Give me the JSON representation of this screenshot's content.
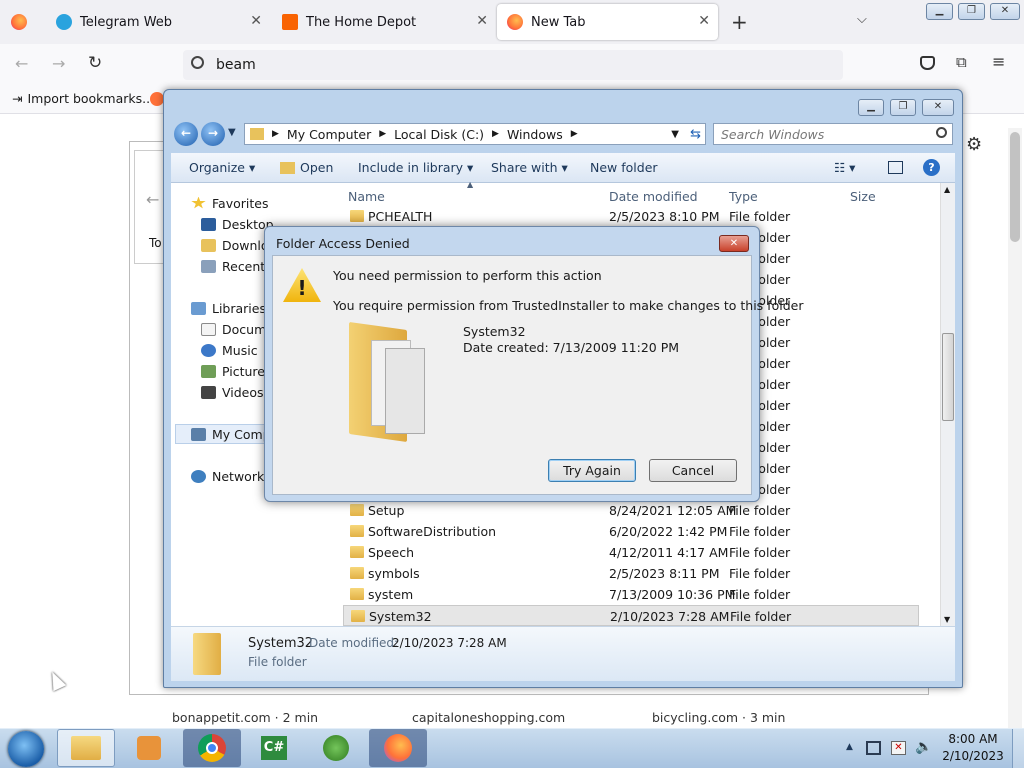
{
  "browser": {
    "tabs": [
      {
        "title": "Telegram Web",
        "icon": "telegram-icon",
        "color": "#2aa3de"
      },
      {
        "title": "The Home Depot",
        "icon": "home-depot-icon",
        "color": "#f96302"
      },
      {
        "title": "New Tab",
        "icon": "firefox-icon",
        "color": "#ff7139"
      }
    ],
    "url": "beam",
    "bookmarks": {
      "import_label": "Import bookmarks..."
    },
    "newtab": {
      "partial_text": "To",
      "story_labels": [
        "bonappetit.com · 2 min",
        "capitaloneshopping.com",
        "bicycling.com · 3 min"
      ]
    }
  },
  "explorer": {
    "breadcrumb": [
      "My Computer",
      "Local Disk (C:)",
      "Windows"
    ],
    "search_placeholder": "Search Windows",
    "commands": [
      "Organize",
      "Open",
      "Include in library",
      "Share with",
      "New folder"
    ],
    "nav": {
      "favorites_header": "Favorites",
      "favorites": [
        "Desktop",
        "Downloads",
        "Recent Places"
      ],
      "libraries_header": "Libraries",
      "libraries": [
        "Documents",
        "Music",
        "Pictures",
        "Videos"
      ],
      "computer": "My Computer",
      "network": "Network"
    },
    "columns": [
      "Name",
      "Date modified",
      "Type",
      "Size"
    ],
    "files": [
      {
        "name": "PCHEALTH",
        "date": "2/5/2023 8:10 PM",
        "type": "File folder"
      },
      {
        "name": "",
        "date": "",
        "type": "File folder"
      },
      {
        "name": "",
        "date": "",
        "type": "File folder"
      },
      {
        "name": "",
        "date": "",
        "type": "File folder"
      },
      {
        "name": "",
        "date": "",
        "type": "File folder"
      },
      {
        "name": "",
        "date": "",
        "type": "File folder"
      },
      {
        "name": "",
        "date": "",
        "type": "File folder"
      },
      {
        "name": "",
        "date": "",
        "type": "File folder"
      },
      {
        "name": "",
        "date": "",
        "type": "File folder"
      },
      {
        "name": "",
        "date": "",
        "type": "File folder"
      },
      {
        "name": "",
        "date": "",
        "type": "File folder"
      },
      {
        "name": "",
        "date": "",
        "type": "File folder"
      },
      {
        "name": "",
        "date": "",
        "type": "File folder"
      },
      {
        "name": "",
        "date": "",
        "type": "File folder"
      },
      {
        "name": "Setup",
        "date": "8/24/2021 12:05 AM",
        "type": "File folder"
      },
      {
        "name": "SoftwareDistribution",
        "date": "6/20/2022 1:42 PM",
        "type": "File folder"
      },
      {
        "name": "Speech",
        "date": "4/12/2011 4:17 AM",
        "type": "File folder"
      },
      {
        "name": "symbols",
        "date": "2/5/2023 8:11 PM",
        "type": "File folder"
      },
      {
        "name": "system",
        "date": "7/13/2009 10:36 PM",
        "type": "File folder"
      },
      {
        "name": "System32",
        "date": "2/10/2023 7:28 AM",
        "type": "File folder"
      }
    ],
    "details": {
      "name": "System32",
      "date_label": "Date modified:",
      "date_value": "2/10/2023 7:28 AM",
      "type": "File folder"
    }
  },
  "dialog": {
    "title": "Folder Access Denied",
    "heading": "You need permission to perform this action",
    "message": "You require permission from TrustedInstaller to make changes to this folder",
    "folder_name": "System32",
    "date_created": "Date created: 7/13/2009 11:20 PM",
    "try_again": "Try Again",
    "cancel": "Cancel"
  },
  "taskbar": {
    "time": "8:00 AM",
    "date": "2/10/2023"
  }
}
